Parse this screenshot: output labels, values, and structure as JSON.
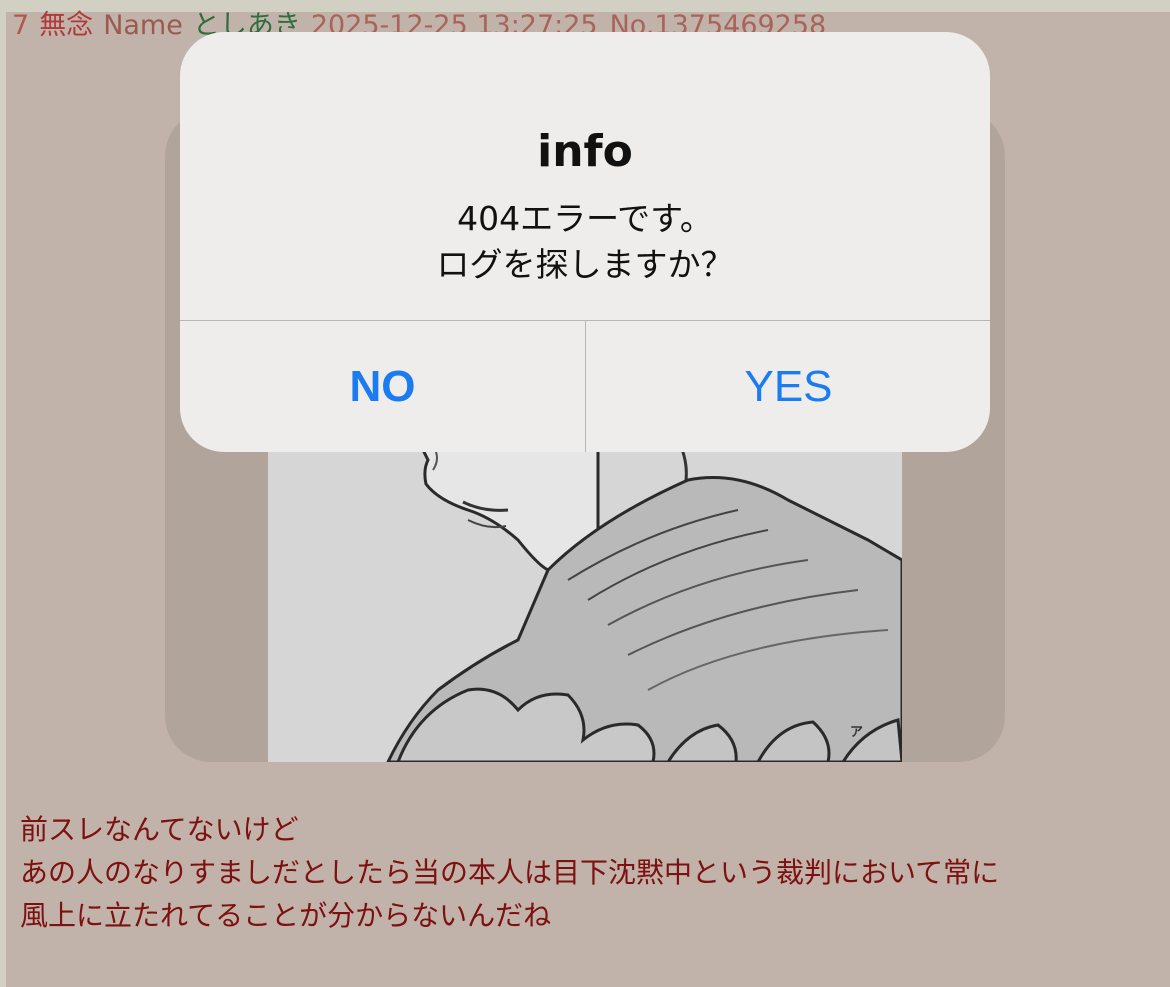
{
  "post": {
    "number": "7",
    "subject": "無念",
    "name_label": "Name",
    "name": "としあき",
    "datetime": "2025-12-25 13:27:25",
    "no": "No.1375469258",
    "body_lines": [
      "前スレなんてないけど",
      "あの人のなりすましだとしたら当の本人は目下沈黙中という裁判において常に",
      "風上に立たれてることが分からないんだね"
    ]
  },
  "dialog": {
    "title": "info",
    "message_lines": [
      "404エラーです。",
      "ログを探しますか？"
    ],
    "no_label": "NO",
    "yes_label": "YES"
  },
  "colors": {
    "accent": "#1a7cf0",
    "body_text": "#7d1010",
    "name": "#2e6d3d"
  },
  "image": {
    "corner_mark": "ア"
  }
}
